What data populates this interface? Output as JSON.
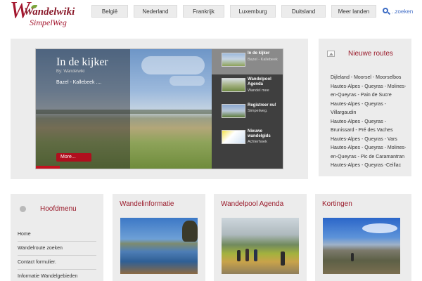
{
  "logo": {
    "name": "Wandelwiki",
    "tagline": "SimpelWeg"
  },
  "nav": [
    "België",
    "Nederland",
    "Frankrijk",
    "Luxemburg",
    "Duitsland",
    "Meer landen"
  ],
  "search": {
    "placeholder": "..zoeken",
    "icon": "search-icon"
  },
  "featured": {
    "title": "In de kijker",
    "byline": "By: Wandelwiki",
    "subtitle": "Bazel - Kallebeek ....",
    "more_label": "More...",
    "items": [
      {
        "title": "In de kijker",
        "snippet": "Bazel - Kallebeek"
      },
      {
        "title": "Wandelpool Agenda",
        "snippet": "Wandel mee"
      },
      {
        "title": "Registreer nu!",
        "snippet": "Simpelweg."
      },
      {
        "title": "Nieuwe wandelgids",
        "snippet": "Achterhoek"
      }
    ]
  },
  "new_routes": {
    "title": "Nieuwe routes",
    "items": [
      "Dijleland - Moorsel - Moorselbos",
      "Hautes-Alpes - Queyras - Molines-en-Queyras - Pain de Sucre",
      "Hautes-Alpes - Queyras - Villargaudin",
      "Hautes-Alpes - Queyras - Brunissard - Pré des Vaches",
      "Hautes-Alpes - Queyras - Vars",
      "Hautes-Alpes - Queyras - Molines-en-Queyras - Pic de Caramantran",
      "Hautes-Alpes - Queyras -Ceillac"
    ]
  },
  "main_menu": {
    "title": "Hoofdmenu",
    "items": [
      "Home",
      "Wandelroute zoeken",
      "Contact formulier.",
      "Informatie Wandelgebieden"
    ]
  },
  "sections": [
    {
      "title": "Wandelinformatie"
    },
    {
      "title": "Wandelpool Agenda"
    },
    {
      "title": "Kortingen"
    }
  ],
  "colors": {
    "accent": "#9a1b2b",
    "button_red": "#b00f1e",
    "panel_bg": "#ececec",
    "link_blue": "#4a74c9"
  }
}
